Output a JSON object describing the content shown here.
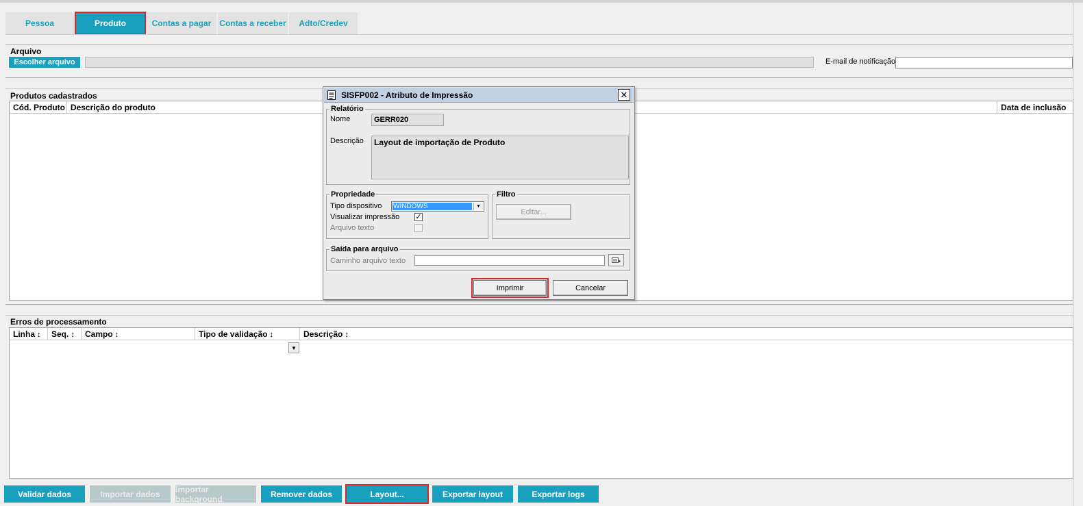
{
  "tabs": [
    {
      "label": "Pessoa"
    },
    {
      "label": "Produto"
    },
    {
      "label": "Contas a pagar"
    },
    {
      "label": "Contas a receber"
    },
    {
      "label": "Adto/Credev"
    }
  ],
  "active_tab": "Produto",
  "arquivo": {
    "title": "Arquivo",
    "choose_button": "Escolher arquivo",
    "email_label": "E-mail de notificação",
    "email_value": ""
  },
  "produtos": {
    "title": "Produtos cadastrados",
    "columns": [
      "Cód. Produto",
      "Descrição do produto",
      "Data de inclusão"
    ],
    "rows": []
  },
  "erros": {
    "title": "Erros de processamento",
    "columns": [
      "Linha",
      "Seq.",
      "Campo",
      "Tipo de validação",
      "Descrição"
    ],
    "sort_icon": "↕",
    "rows": []
  },
  "bottom_buttons": [
    {
      "label": "Validar dados",
      "enabled": true
    },
    {
      "label": "Importar dados",
      "enabled": false
    },
    {
      "label": "Importar background",
      "enabled": false
    },
    {
      "label": "Remover dados",
      "enabled": true
    },
    {
      "label": "Layout...",
      "enabled": true
    },
    {
      "label": "Exportar layout",
      "enabled": true
    },
    {
      "label": "Exportar logs",
      "enabled": true
    }
  ],
  "dialog": {
    "title": "SISFP002 - Atributo de Impressão",
    "close_glyph": "✕",
    "relatorio": {
      "legend": "Relatório",
      "nome_label": "Nome",
      "nome_value": "GERR020",
      "descricao_label": "Descrição",
      "descricao_value": "Layout de importação de Produto"
    },
    "propriedade": {
      "legend": "Propriedade",
      "tipo_label": "Tipo dispositivo",
      "tipo_value": "WINDOWS",
      "visualizar_label": "Visualizar impressão",
      "visualizar_checked": true,
      "arquivo_texto_label": "Arquivo texto",
      "arquivo_texto_checked": false
    },
    "filtro": {
      "legend": "Filtro",
      "editar_button": "Editar..."
    },
    "saida": {
      "legend": "Saída para arquivo",
      "caminho_label": "Caminho arquivo texto",
      "caminho_value": ""
    },
    "imprimir_button": "Imprimir",
    "cancelar_button": "Cancelar"
  },
  "colors": {
    "accent": "#1aa0bf",
    "highlight": "#d9272e",
    "dialog_title_bg": "#c2d0e4"
  }
}
